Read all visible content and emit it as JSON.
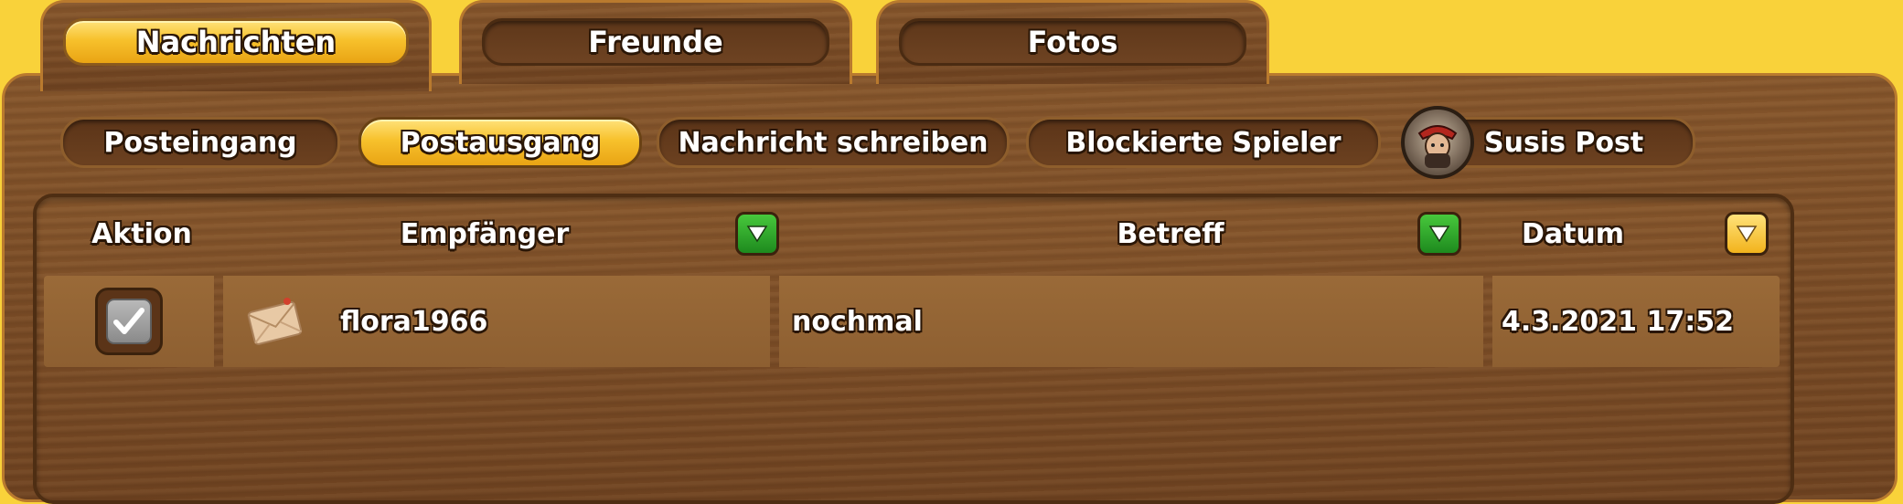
{
  "tabs": [
    {
      "label": "Nachrichten",
      "active": true
    },
    {
      "label": "Freunde",
      "active": false
    },
    {
      "label": "Fotos",
      "active": false
    }
  ],
  "subtabs": [
    {
      "label": "Posteingang",
      "active": false
    },
    {
      "label": "Postausgang",
      "active": true
    },
    {
      "label": "Nachricht schreiben",
      "active": false
    },
    {
      "label": "Blockierte Spieler",
      "active": false
    },
    {
      "label": "Susis Post",
      "active": false,
      "icon": "avatar-icon"
    }
  ],
  "table": {
    "columns": [
      {
        "label": "Aktion",
        "sort": null
      },
      {
        "label": "Empfänger",
        "sort": "down-green"
      },
      {
        "label": "Betreff",
        "sort": "down-green"
      },
      {
        "label": "Datum",
        "sort": "down-yellow"
      }
    ],
    "rows": [
      {
        "checked": true,
        "icon": "envelope-icon",
        "recipient": "flora1966",
        "subject": "nochmal",
        "date": "4.3.2021 17:52"
      }
    ]
  },
  "colors": {
    "background": "#f9d23a",
    "wood": "#7a4a25",
    "active_tab": "#f7c12c",
    "sort_green": "#2f9f2a",
    "sort_yellow": "#f2b31c"
  }
}
